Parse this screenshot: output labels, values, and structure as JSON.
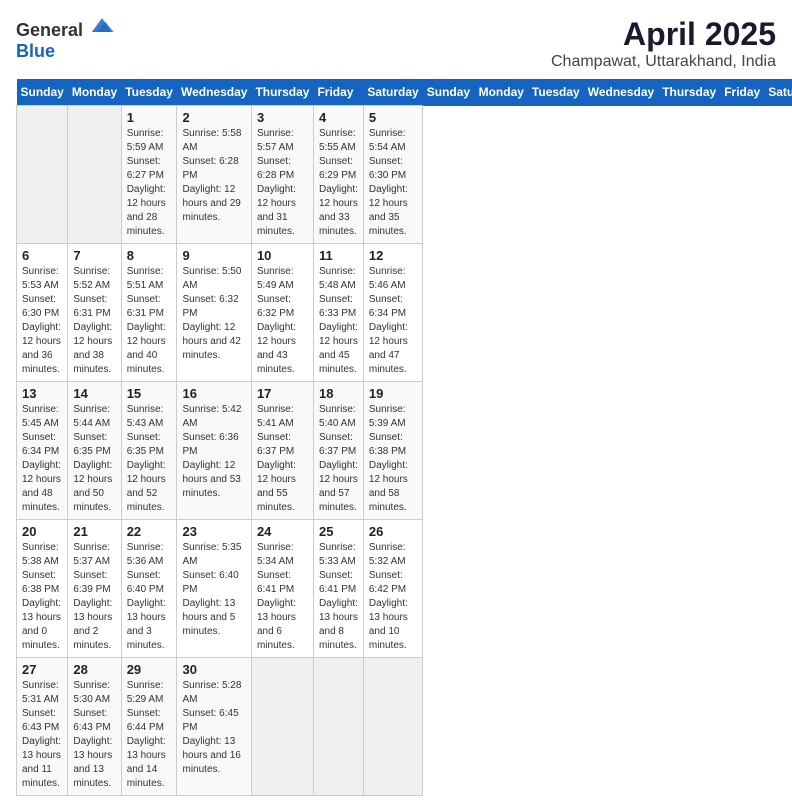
{
  "header": {
    "logo_general": "General",
    "logo_blue": "Blue",
    "title": "April 2025",
    "subtitle": "Champawat, Uttarakhand, India"
  },
  "calendar": {
    "days_of_week": [
      "Sunday",
      "Monday",
      "Tuesday",
      "Wednesday",
      "Thursday",
      "Friday",
      "Saturday"
    ],
    "weeks": [
      [
        {
          "date": "",
          "sunrise": "",
          "sunset": "",
          "daylight": ""
        },
        {
          "date": "",
          "sunrise": "",
          "sunset": "",
          "daylight": ""
        },
        {
          "date": "1",
          "sunrise": "Sunrise: 5:59 AM",
          "sunset": "Sunset: 6:27 PM",
          "daylight": "Daylight: 12 hours and 28 minutes."
        },
        {
          "date": "2",
          "sunrise": "Sunrise: 5:58 AM",
          "sunset": "Sunset: 6:28 PM",
          "daylight": "Daylight: 12 hours and 29 minutes."
        },
        {
          "date": "3",
          "sunrise": "Sunrise: 5:57 AM",
          "sunset": "Sunset: 6:28 PM",
          "daylight": "Daylight: 12 hours and 31 minutes."
        },
        {
          "date": "4",
          "sunrise": "Sunrise: 5:55 AM",
          "sunset": "Sunset: 6:29 PM",
          "daylight": "Daylight: 12 hours and 33 minutes."
        },
        {
          "date": "5",
          "sunrise": "Sunrise: 5:54 AM",
          "sunset": "Sunset: 6:30 PM",
          "daylight": "Daylight: 12 hours and 35 minutes."
        }
      ],
      [
        {
          "date": "6",
          "sunrise": "Sunrise: 5:53 AM",
          "sunset": "Sunset: 6:30 PM",
          "daylight": "Daylight: 12 hours and 36 minutes."
        },
        {
          "date": "7",
          "sunrise": "Sunrise: 5:52 AM",
          "sunset": "Sunset: 6:31 PM",
          "daylight": "Daylight: 12 hours and 38 minutes."
        },
        {
          "date": "8",
          "sunrise": "Sunrise: 5:51 AM",
          "sunset": "Sunset: 6:31 PM",
          "daylight": "Daylight: 12 hours and 40 minutes."
        },
        {
          "date": "9",
          "sunrise": "Sunrise: 5:50 AM",
          "sunset": "Sunset: 6:32 PM",
          "daylight": "Daylight: 12 hours and 42 minutes."
        },
        {
          "date": "10",
          "sunrise": "Sunrise: 5:49 AM",
          "sunset": "Sunset: 6:32 PM",
          "daylight": "Daylight: 12 hours and 43 minutes."
        },
        {
          "date": "11",
          "sunrise": "Sunrise: 5:48 AM",
          "sunset": "Sunset: 6:33 PM",
          "daylight": "Daylight: 12 hours and 45 minutes."
        },
        {
          "date": "12",
          "sunrise": "Sunrise: 5:46 AM",
          "sunset": "Sunset: 6:34 PM",
          "daylight": "Daylight: 12 hours and 47 minutes."
        }
      ],
      [
        {
          "date": "13",
          "sunrise": "Sunrise: 5:45 AM",
          "sunset": "Sunset: 6:34 PM",
          "daylight": "Daylight: 12 hours and 48 minutes."
        },
        {
          "date": "14",
          "sunrise": "Sunrise: 5:44 AM",
          "sunset": "Sunset: 6:35 PM",
          "daylight": "Daylight: 12 hours and 50 minutes."
        },
        {
          "date": "15",
          "sunrise": "Sunrise: 5:43 AM",
          "sunset": "Sunset: 6:35 PM",
          "daylight": "Daylight: 12 hours and 52 minutes."
        },
        {
          "date": "16",
          "sunrise": "Sunrise: 5:42 AM",
          "sunset": "Sunset: 6:36 PM",
          "daylight": "Daylight: 12 hours and 53 minutes."
        },
        {
          "date": "17",
          "sunrise": "Sunrise: 5:41 AM",
          "sunset": "Sunset: 6:37 PM",
          "daylight": "Daylight: 12 hours and 55 minutes."
        },
        {
          "date": "18",
          "sunrise": "Sunrise: 5:40 AM",
          "sunset": "Sunset: 6:37 PM",
          "daylight": "Daylight: 12 hours and 57 minutes."
        },
        {
          "date": "19",
          "sunrise": "Sunrise: 5:39 AM",
          "sunset": "Sunset: 6:38 PM",
          "daylight": "Daylight: 12 hours and 58 minutes."
        }
      ],
      [
        {
          "date": "20",
          "sunrise": "Sunrise: 5:38 AM",
          "sunset": "Sunset: 6:38 PM",
          "daylight": "Daylight: 13 hours and 0 minutes."
        },
        {
          "date": "21",
          "sunrise": "Sunrise: 5:37 AM",
          "sunset": "Sunset: 6:39 PM",
          "daylight": "Daylight: 13 hours and 2 minutes."
        },
        {
          "date": "22",
          "sunrise": "Sunrise: 5:36 AM",
          "sunset": "Sunset: 6:40 PM",
          "daylight": "Daylight: 13 hours and 3 minutes."
        },
        {
          "date": "23",
          "sunrise": "Sunrise: 5:35 AM",
          "sunset": "Sunset: 6:40 PM",
          "daylight": "Daylight: 13 hours and 5 minutes."
        },
        {
          "date": "24",
          "sunrise": "Sunrise: 5:34 AM",
          "sunset": "Sunset: 6:41 PM",
          "daylight": "Daylight: 13 hours and 6 minutes."
        },
        {
          "date": "25",
          "sunrise": "Sunrise: 5:33 AM",
          "sunset": "Sunset: 6:41 PM",
          "daylight": "Daylight: 13 hours and 8 minutes."
        },
        {
          "date": "26",
          "sunrise": "Sunrise: 5:32 AM",
          "sunset": "Sunset: 6:42 PM",
          "daylight": "Daylight: 13 hours and 10 minutes."
        }
      ],
      [
        {
          "date": "27",
          "sunrise": "Sunrise: 5:31 AM",
          "sunset": "Sunset: 6:43 PM",
          "daylight": "Daylight: 13 hours and 11 minutes."
        },
        {
          "date": "28",
          "sunrise": "Sunrise: 5:30 AM",
          "sunset": "Sunset: 6:43 PM",
          "daylight": "Daylight: 13 hours and 13 minutes."
        },
        {
          "date": "29",
          "sunrise": "Sunrise: 5:29 AM",
          "sunset": "Sunset: 6:44 PM",
          "daylight": "Daylight: 13 hours and 14 minutes."
        },
        {
          "date": "30",
          "sunrise": "Sunrise: 5:28 AM",
          "sunset": "Sunset: 6:45 PM",
          "daylight": "Daylight: 13 hours and 16 minutes."
        },
        {
          "date": "",
          "sunrise": "",
          "sunset": "",
          "daylight": ""
        },
        {
          "date": "",
          "sunrise": "",
          "sunset": "",
          "daylight": ""
        },
        {
          "date": "",
          "sunrise": "",
          "sunset": "",
          "daylight": ""
        }
      ]
    ]
  }
}
